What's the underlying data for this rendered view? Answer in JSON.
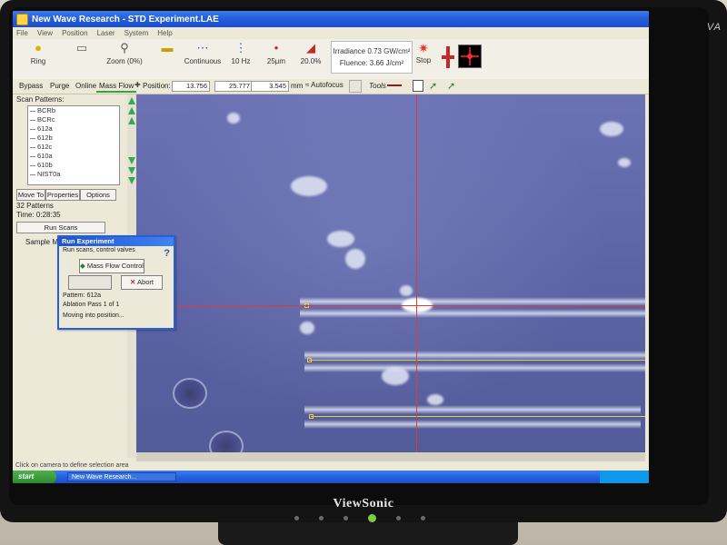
{
  "monitor": {
    "brand": "ViewSonic",
    "model_fragment": "VA"
  },
  "window": {
    "title": "New Wave Research - STD Experiment.LAE"
  },
  "menu": [
    "File",
    "View",
    "Position",
    "Laser",
    "System",
    "Help"
  ],
  "toolbar": {
    "ring_label": "Ring",
    "zoom_label": "Zoom (0%)",
    "mode_label": "Continuous",
    "rep_rate": "10 Hz",
    "spot_size": "25µm",
    "energy": "20.0%",
    "irradiance": "Irradiance 0.73 GW/cm²",
    "fluence": "Fluence: 3.66 J/cm²",
    "stop_label": "Stop"
  },
  "toolbar2": {
    "tabs": [
      "Bypass",
      "Purge",
      "Online",
      "Mass Flow"
    ],
    "active_tab": "Mass Flow",
    "position_label": "Position:",
    "x": "13.756",
    "y": "25.777",
    "z": "3.545",
    "unit": "mm",
    "autofocus": "Autofocus",
    "tools_label": "Tools"
  },
  "left_panel": {
    "scan_patterns_label": "Scan Patterns:",
    "patterns": [
      "BCRb",
      "BCRc",
      "612a",
      "612b",
      "612c",
      "610a",
      "610b",
      "NIST0a"
    ],
    "move_to": "Move To",
    "properties": "Properties",
    "options": "Options",
    "pattern_count": "32 Patterns",
    "time": "Time: 0:28:35",
    "run_scans": "Run Scans",
    "sample_map": "Sample Map"
  },
  "dialog": {
    "title": "Run Experiment",
    "line1": "Run scans, control valves",
    "mass_flow_button": "Mass Flow Control",
    "abort_button": "Abort",
    "pattern": "Pattern: 612a",
    "pass": "Ablation Pass 1 of 1",
    "status": "Moving into position..."
  },
  "statusbar": {
    "text": "Click on camera to define selection area"
  },
  "taskbar": {
    "start": "start",
    "item": "New Wave Research...",
    "time": ""
  },
  "colors": {
    "titlebar": "#245edb",
    "camera_bg": "#5c64a6",
    "scanline": "#e8d13a",
    "crosshair": "#e03a3a"
  }
}
